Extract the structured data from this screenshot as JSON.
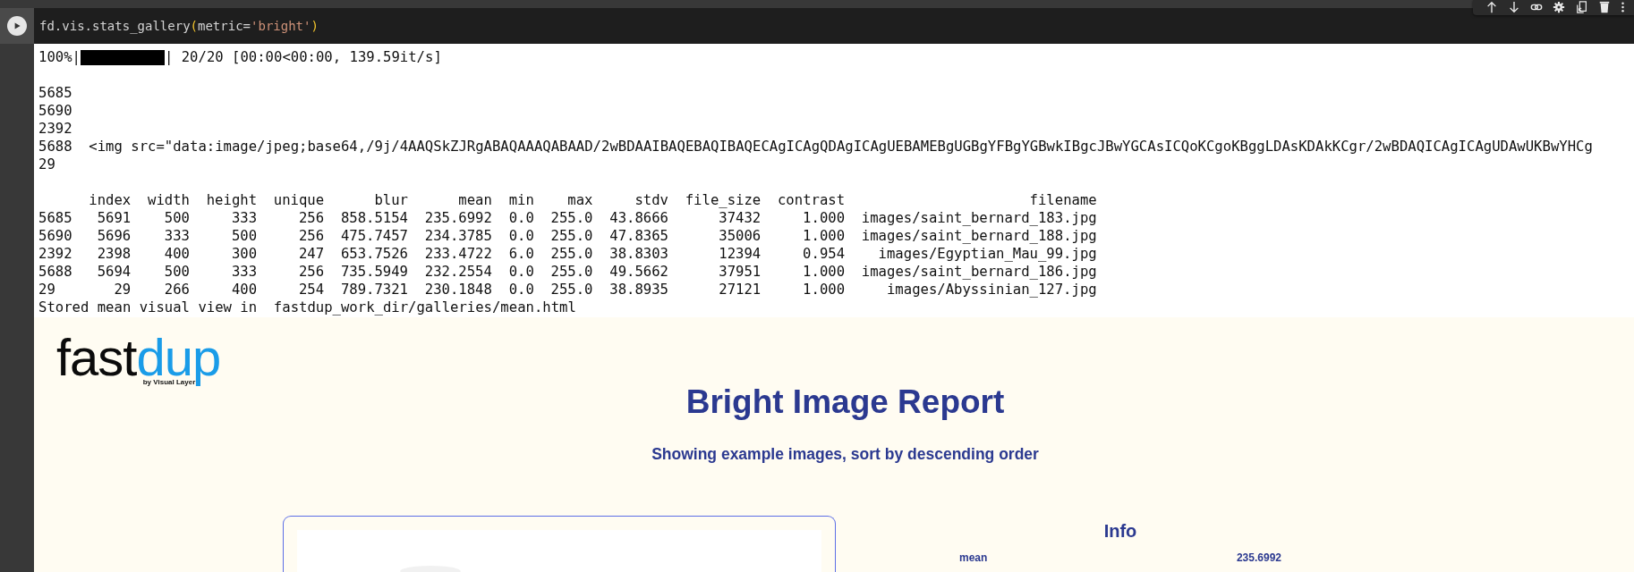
{
  "cell": {
    "code_tokens": [
      {
        "kind": "plain",
        "text": "fd.vis.stats_gallery"
      },
      {
        "kind": "paren",
        "text": "("
      },
      {
        "kind": "plain",
        "text": "metric="
      },
      {
        "kind": "string",
        "text": "'bright'"
      },
      {
        "kind": "paren",
        "text": ")"
      }
    ]
  },
  "output": {
    "progress": {
      "percent": "100%|",
      "level": 1,
      "stats": "| 20/20 [00:00<00:00, 139.59it/s]"
    },
    "lines": [
      {
        "index": "5685"
      },
      {
        "index": "5690"
      },
      {
        "index": "2392"
      },
      {
        "index": "5688",
        "html": "<img src=\"data:image/jpeg;base64,/9j/4AAQSkZJRgABAQAAAQABAAD/2wBDAAIBAQEBAQIBAQECAgICAgQDAgICAgUEBAMEBgUGBgYFBgYGBwkIBgcJBwYGCAsICQoKCgoKBggLDAsKDAkKCgr/2wBDAQICAgICAgUDAwUKBwYHCg"
      },
      {
        "index": "29"
      }
    ],
    "table": {
      "columns": [
        "index",
        "width",
        "height",
        "unique",
        "blur",
        "mean",
        "min",
        "max",
        "stdv",
        "file_size",
        "contrast",
        "filename"
      ],
      "rows": [
        {
          "label": "5685",
          "cells": [
            "5691",
            "500",
            "333",
            "256",
            "858.5154",
            "235.6992",
            "0.0",
            "255.0",
            "43.8666",
            "37432",
            "1.000",
            "images/saint_bernard_183.jpg"
          ]
        },
        {
          "label": "5690",
          "cells": [
            "5696",
            "333",
            "500",
            "256",
            "475.7457",
            "234.3785",
            "0.0",
            "255.0",
            "47.8365",
            "35006",
            "1.000",
            "images/saint_bernard_188.jpg"
          ]
        },
        {
          "label": "2392",
          "cells": [
            "2398",
            "400",
            "300",
            "247",
            "653.7526",
            "233.4722",
            "6.0",
            "255.0",
            "38.8303",
            "12394",
            "0.954",
            "images/Egyptian_Mau_99.jpg"
          ]
        },
        {
          "label": "5688",
          "cells": [
            "5694",
            "500",
            "333",
            "256",
            "735.5949",
            "232.2554",
            "0.0",
            "255.0",
            "49.5662",
            "37951",
            "1.000",
            "images/saint_bernard_186.jpg"
          ]
        },
        {
          "label": "29",
          "cells": [
            "29",
            "266",
            "400",
            "254",
            "789.7321",
            "230.1848",
            "0.0",
            "255.0",
            "38.8935",
            "27121",
            "1.000",
            "images/Abyssinian_127.jpg"
          ]
        }
      ]
    },
    "stored_message": "Stored mean visual view in  fastdup_work_dir/galleries/mean.html"
  },
  "report": {
    "logo": {
      "word_1": "fast",
      "word_2": "dup",
      "tagline": "by Visual Layer"
    },
    "title": "Bright Image Report",
    "subtitle": "Showing example images, sort by descending order",
    "info": {
      "heading": "Info",
      "rows": [
        {
          "label": "mean",
          "value": "235.6992"
        }
      ]
    }
  }
}
